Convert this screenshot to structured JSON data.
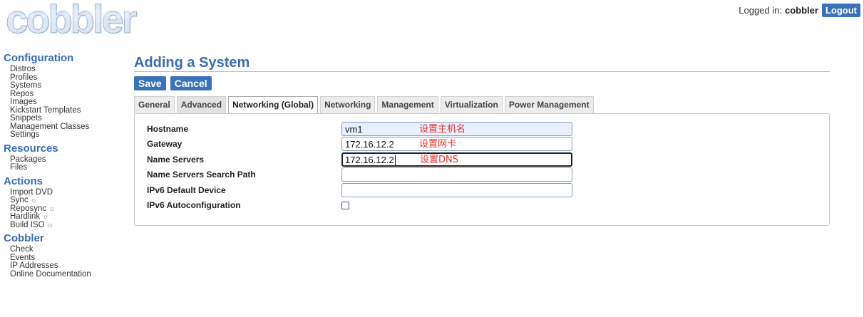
{
  "logo": {
    "text": "cobbler"
  },
  "login": {
    "label": "Logged in:",
    "username": "cobbler",
    "logout_label": "Logout"
  },
  "sidebar": {
    "sections": [
      {
        "heading": "Configuration",
        "items": [
          "Distros",
          "Profiles",
          "Systems",
          "Repos",
          "Images",
          "Kickstart Templates",
          "Snippets",
          "Management Classes",
          "Settings"
        ]
      },
      {
        "heading": "Resources",
        "items": [
          "Packages",
          "Files"
        ]
      },
      {
        "heading": "Actions",
        "items": [
          "Import DVD",
          "Sync",
          "Reposync",
          "Hardlink",
          "Build ISO"
        ]
      },
      {
        "heading": "Cobbler",
        "items": [
          "Check",
          "Events",
          "IP Addresses",
          "Online Documentation"
        ]
      }
    ],
    "sun_glyph": "☼"
  },
  "main": {
    "title": "Adding a System",
    "save_label": "Save",
    "cancel_label": "Cancel",
    "tabs": [
      "General",
      "Advanced",
      "Networking (Global)",
      "Networking",
      "Management",
      "Virtualization",
      "Power Management"
    ],
    "active_tab": "Networking (Global)",
    "fields": [
      {
        "label": "Hostname",
        "value": "vm1",
        "note": "设置主机名"
      },
      {
        "label": "Gateway",
        "value": "172.16.12.2",
        "note": "设置网卡"
      },
      {
        "label": "Name Servers",
        "value": "172.16.12.2",
        "note": "设置DNS"
      },
      {
        "label": "Name Servers Search Path",
        "value": "",
        "note": ""
      },
      {
        "label": "IPv6 Default Device",
        "value": "",
        "note": ""
      }
    ],
    "checkbox_field": {
      "label": "IPv6 Autoconfiguration",
      "checked": false
    }
  },
  "colors": {
    "accent": "#3a6db1",
    "button": "#3b73b9",
    "note": "#e8322a"
  }
}
